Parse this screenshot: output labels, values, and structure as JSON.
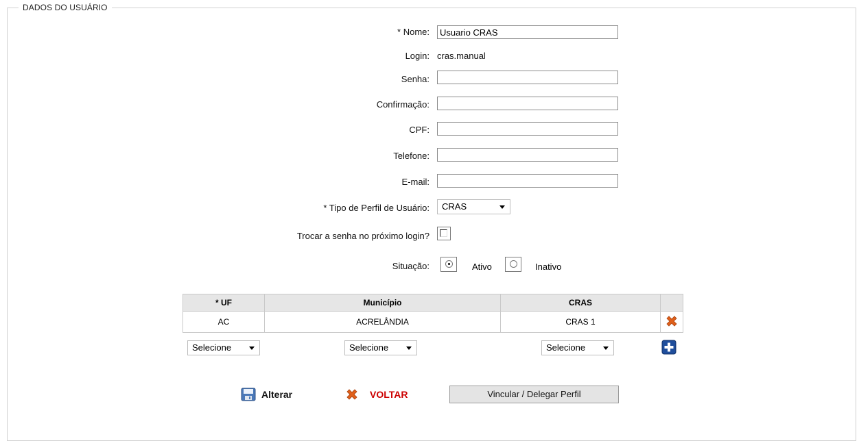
{
  "section_title": "DADOS DO USUÁRIO",
  "form": {
    "nome_label": "* Nome:",
    "nome_value": "Usuario CRAS",
    "login_label": "Login:",
    "login_value": "cras.manual",
    "senha_label": "Senha:",
    "confirmacao_label": "Confirmação:",
    "cpf_label": "CPF:",
    "telefone_label": "Telefone:",
    "email_label": "E-mail:",
    "tipo_perfil_label": "* Tipo de Perfil de Usuário:",
    "tipo_perfil_value": "CRAS",
    "trocar_senha_label": "Trocar a senha no próximo login?",
    "situacao_label": "Situação:",
    "situacao_options": [
      "Ativo",
      "Inativo"
    ],
    "situacao_selected": "Ativo"
  },
  "table": {
    "headers": [
      "* UF",
      "Município",
      "CRAS",
      ""
    ],
    "rows": [
      {
        "uf": "AC",
        "municipio": "ACRELÂNDIA",
        "cras": "CRAS 1"
      }
    ],
    "select_placeholder": "Selecione"
  },
  "actions": {
    "alterar": "Alterar",
    "voltar": "VOLTAR",
    "vincular": "Vincular / Delegar Perfil"
  },
  "colors": {
    "voltar_text": "#cc0000",
    "delete_icon": "#e0601a",
    "add_icon": "#1f4e9c"
  }
}
